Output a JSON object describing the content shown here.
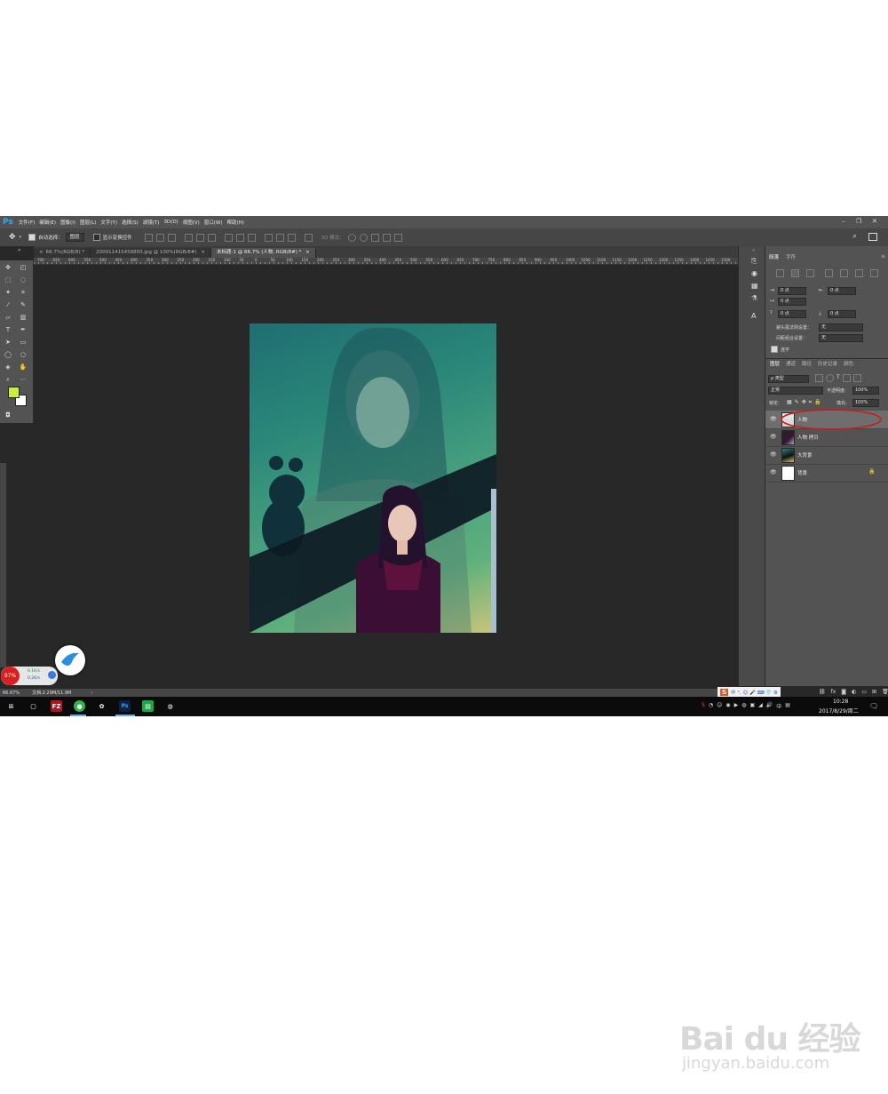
{
  "app": {
    "logo": "Ps",
    "menu": [
      "文件(F)",
      "编辑(E)",
      "图像(I)",
      "图层(L)",
      "文字(Y)",
      "选择(S)",
      "滤镜(T)",
      "3D(D)",
      "视图(V)",
      "窗口(W)",
      "帮助(H)"
    ],
    "window_controls": [
      "–",
      "❐",
      "✕"
    ]
  },
  "options": {
    "auto_select_label": "自动选择：",
    "auto_select_value": "图层",
    "show_transform_label": "显示变换控件",
    "mode_3d_label": "3D 模式："
  },
  "tabs": [
    {
      "label": "66.7%(RGB/8) *",
      "close": "×"
    },
    {
      "label": "200911415458850.jpg @ 100%(RGB/8#)",
      "close": "×"
    },
    {
      "label": "未标题-1 @ 66.7% (人物, RGB/8#) *",
      "close": "×"
    }
  ],
  "ruler_labels": [
    "700",
    "650",
    "600",
    "550",
    "500",
    "450",
    "400",
    "350",
    "300",
    "250",
    "200",
    "150",
    "100",
    "50",
    "0",
    "50",
    "100",
    "150",
    "200",
    "250",
    "300",
    "350",
    "400",
    "450",
    "500",
    "550",
    "600",
    "650",
    "700",
    "750",
    "800",
    "850",
    "900",
    "950",
    "1000",
    "1050",
    "1100",
    "1150",
    "1200",
    "1250",
    "1300",
    "1350",
    "1400",
    "1450",
    "1500"
  ],
  "paragraph_panel": {
    "tabs": [
      "段落",
      "字符"
    ],
    "indent_left": "0 点",
    "indent_right": "0 点",
    "indent_first": "0 点",
    "space_before": "0 点",
    "space_after": "0 点",
    "kinsoku_label": "避头尾法则设置：",
    "kinsoku_value": "无",
    "mojikumi_label": "间距组合设置：",
    "mojikumi_value": "无",
    "hyphenate_label": "连字"
  },
  "layers_panel": {
    "tabs": [
      "图层",
      "通道",
      "路径",
      "历史记录",
      "颜色"
    ],
    "filter_label": "ρ 类型",
    "blend_mode": "正常",
    "opacity_label": "不透明度:",
    "opacity_value": "100%",
    "lock_label": "锁定:",
    "fill_label": "填充:",
    "fill_value": "100%",
    "layers": [
      {
        "name": "人物",
        "selected": true
      },
      {
        "name": "人物 拷贝",
        "selected": false
      },
      {
        "name": "大背景",
        "selected": false
      },
      {
        "name": "背景",
        "selected": false
      }
    ]
  },
  "status": {
    "zoom": "66.67%",
    "doc": "文档:2.29M/11.9M"
  },
  "overlay": {
    "percent": "97%",
    "up_speed": "0.1K/s",
    "down_speed": "0.2K/s"
  },
  "ime_bar": "中 °, ☺ 🎤 ⌨ 👕 ⚙",
  "clock": {
    "time": "10:28",
    "date": "2017/8/29/周二"
  },
  "watermark": {
    "logo": "Bai du 经验",
    "url": "jingyan.baidu.com"
  },
  "colors": {
    "foreground": "#c8f03c",
    "background": "#ffffff",
    "annotation": "#d01818"
  }
}
